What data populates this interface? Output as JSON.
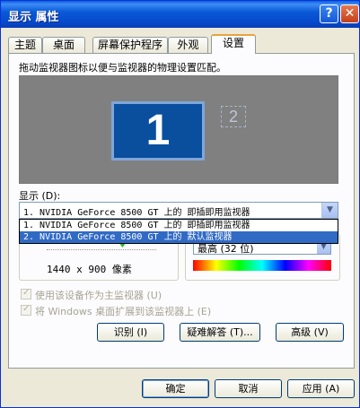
{
  "window": {
    "title": "显示 属性",
    "help_button": "?",
    "close_button": "✕"
  },
  "tabs": [
    "主题",
    "桌面",
    "屏幕保护程序",
    "外观",
    "设置"
  ],
  "settings": {
    "description": "拖动监视器图标以便与监视器的物理设置匹配。",
    "monitor_primary": "1",
    "monitor_secondary": "2",
    "display_label": "显示 (D):",
    "display_selected": "1. NVIDIA GeForce 8500 GT 上的 即插即用监视器",
    "display_options": [
      "1. NVIDIA GeForce 8500 GT 上的 即插即用监视器",
      "2. NVIDIA GeForce 8500 GT 上的 默认监视器"
    ],
    "selected_option_index": 1,
    "resolution_text": "1440 x 900 像素",
    "color_quality_value": "最高 (32 位)",
    "checkbox_primary_label": "使用该设备作为主监视器 (U)",
    "checkbox_extend_label": "将 Windows 桌面扩展到该监视器上 (E)",
    "identify_button": "识别 (I)",
    "troubleshoot_button": "疑难解答 (T)...",
    "advanced_button": "高级 (V)"
  },
  "footer": {
    "ok": "确定",
    "cancel": "取消",
    "apply": "应用 (A)"
  }
}
